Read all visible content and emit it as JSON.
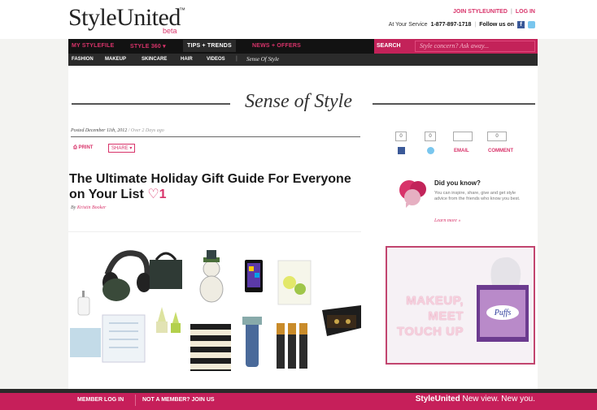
{
  "header": {
    "logo": "StyleUnited",
    "logo_tm": "™",
    "logo_beta": "beta",
    "join_link": "JOIN STYLEUNITED",
    "login_link": "LOG IN",
    "service_text": "At Your Service",
    "phone": "1-877-897-1718",
    "follow_text": "Follow us on"
  },
  "nav": {
    "items": [
      "MY STYLEFILE",
      "STYLE 360 ▾",
      "TIPS + TRENDS",
      "NEWS + OFFERS"
    ],
    "active": "TIPS + TRENDS",
    "search_label": "SEARCH",
    "search_placeholder": "Style concern? Ask away..."
  },
  "subnav": {
    "items": [
      "FASHION",
      "MAKEUP",
      "SKINCARE",
      "HAIR",
      "VIDEOS"
    ],
    "separator": "|",
    "current": "Sense Of Style"
  },
  "article": {
    "section_title": "Sense of Style",
    "posted": "Posted December 11th, 2012",
    "posted_ago": "/ Over 2 Days ago",
    "print": "⎙ PRINT",
    "share": "SHARE ▾",
    "title": "The Ultimate Holiday Gift Guide For Everyone on Your List",
    "heart": "♡",
    "likes": "1",
    "byline_prefix": "By",
    "author": "Kristin Booker"
  },
  "share_bar": {
    "facebook_count": "0",
    "twitter_count": "0",
    "email_count": "",
    "comment_count": "0",
    "email_label": "EMAIL",
    "comment_label": "COMMENT"
  },
  "did_you_know": {
    "title": "Did you know?",
    "text": "You can inspire, share, give and get style advice from the friends who know you best.",
    "link": "Learn more »"
  },
  "ad": {
    "text": "MAKEUP, MEET TOUCH UP",
    "brand": "Puffs"
  },
  "footer": {
    "login": "MEMBER LOG IN",
    "join": "NOT A MEMBER? JOIN US",
    "brand": "StyleUnited",
    "tagline": "New view. New you."
  },
  "colors": {
    "accent": "#d8336a",
    "nav_bg": "#121212",
    "footer_bg": "#c61f5a"
  }
}
